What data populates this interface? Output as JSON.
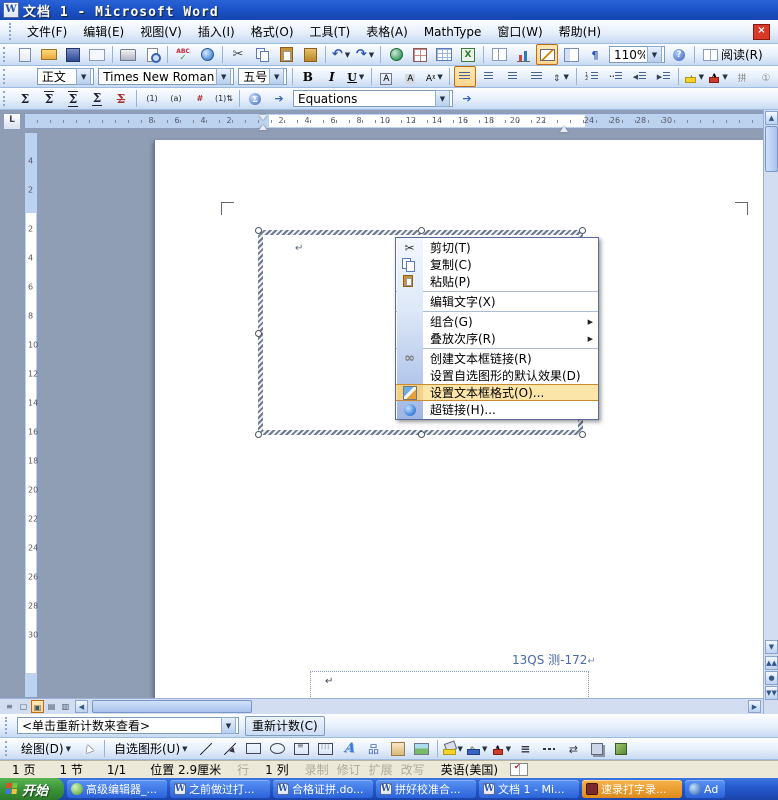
{
  "window": {
    "title": "文档 1 - Microsoft Word"
  },
  "menu": {
    "items": [
      {
        "label": "文件(F)"
      },
      {
        "label": "编辑(E)"
      },
      {
        "label": "视图(V)"
      },
      {
        "label": "插入(I)"
      },
      {
        "label": "格式(O)"
      },
      {
        "label": "工具(T)"
      },
      {
        "label": "表格(A)"
      },
      {
        "label": "MathType"
      },
      {
        "label": "窗口(W)"
      },
      {
        "label": "帮助(H)"
      }
    ],
    "close_glyph": "×"
  },
  "standard_toolbar": {
    "zoom": "110%",
    "read": "阅读(R)"
  },
  "formatting_toolbar": {
    "style": "正文",
    "font": "Times New Roman",
    "size": "五号"
  },
  "mathtype_toolbar": {
    "sigma": "Σ",
    "tag1": "(1)",
    "taga": "(a)",
    "taghash": "#",
    "tagswap": "(1)⇅",
    "arrow": "➔",
    "equations": "Equations"
  },
  "hruler": {
    "left": [
      "8",
      "6",
      "4",
      "2"
    ],
    "mid": [
      "2",
      "4",
      "6",
      "8",
      "10",
      "12",
      "14",
      "16",
      "18",
      "20",
      "22"
    ],
    "right": [
      "24",
      "26",
      "28",
      "30"
    ]
  },
  "vruler": {
    "top": [
      "4",
      "2"
    ],
    "mid": [
      "2",
      "4",
      "6",
      "8",
      "10",
      "12",
      "14",
      "16",
      "18",
      "20",
      "22",
      "24",
      "26",
      "28",
      "30"
    ]
  },
  "page": {
    "heading": "13QS 测-172",
    "para_mark": "↵"
  },
  "context_menu": {
    "items": [
      {
        "label": "剪切(T)",
        "icon": "cut"
      },
      {
        "label": "复制(C)",
        "icon": "copy"
      },
      {
        "label": "粘贴(P)",
        "icon": "paste"
      },
      {
        "sep": true
      },
      {
        "label": "编辑文字(X)"
      },
      {
        "sep": true
      },
      {
        "label": "组合(G)",
        "submenu": true
      },
      {
        "label": "叠放次序(R)",
        "submenu": true
      },
      {
        "sep": true
      },
      {
        "label": "创建文本框链接(R)",
        "icon": "chain"
      },
      {
        "label": "设置自选图形的默认效果(D)"
      },
      {
        "label": "设置文本框格式(O)...",
        "icon": "format-textbox",
        "highlight": true
      },
      {
        "label": "超链接(H)...",
        "icon": "hyperlink"
      }
    ]
  },
  "word_count_bar": {
    "value": "<单击重新计数来查看>",
    "recount": "重新计数(C)"
  },
  "drawing_toolbar": {
    "draw": "绘图(D)",
    "autoshapes": "自选图形(U)"
  },
  "status_bar": {
    "page": "1 页",
    "section": "1 节",
    "page_of": "1/1",
    "position": "位置 2.9厘米",
    "line": "行",
    "column": "1 列",
    "dim": [
      {
        "label": "录制"
      },
      {
        "label": "修订"
      },
      {
        "label": "扩展"
      },
      {
        "label": "改写"
      }
    ],
    "language": "英语(美国)"
  },
  "taskbar": {
    "start": "开始",
    "tasks": [
      {
        "label": "高级编辑器_...",
        "kind": "ie"
      },
      {
        "label": "之前做过打...",
        "kind": "word"
      },
      {
        "label": "合格证拼.do...",
        "kind": "word"
      },
      {
        "label": "拼好校准合...",
        "kind": "word"
      },
      {
        "label": "文档 1 - Mi...",
        "kind": "word"
      },
      {
        "label": "速录打字录...",
        "kind": "flash",
        "active": true
      },
      {
        "label": "Ad",
        "kind": "other",
        "partial": true
      }
    ]
  }
}
